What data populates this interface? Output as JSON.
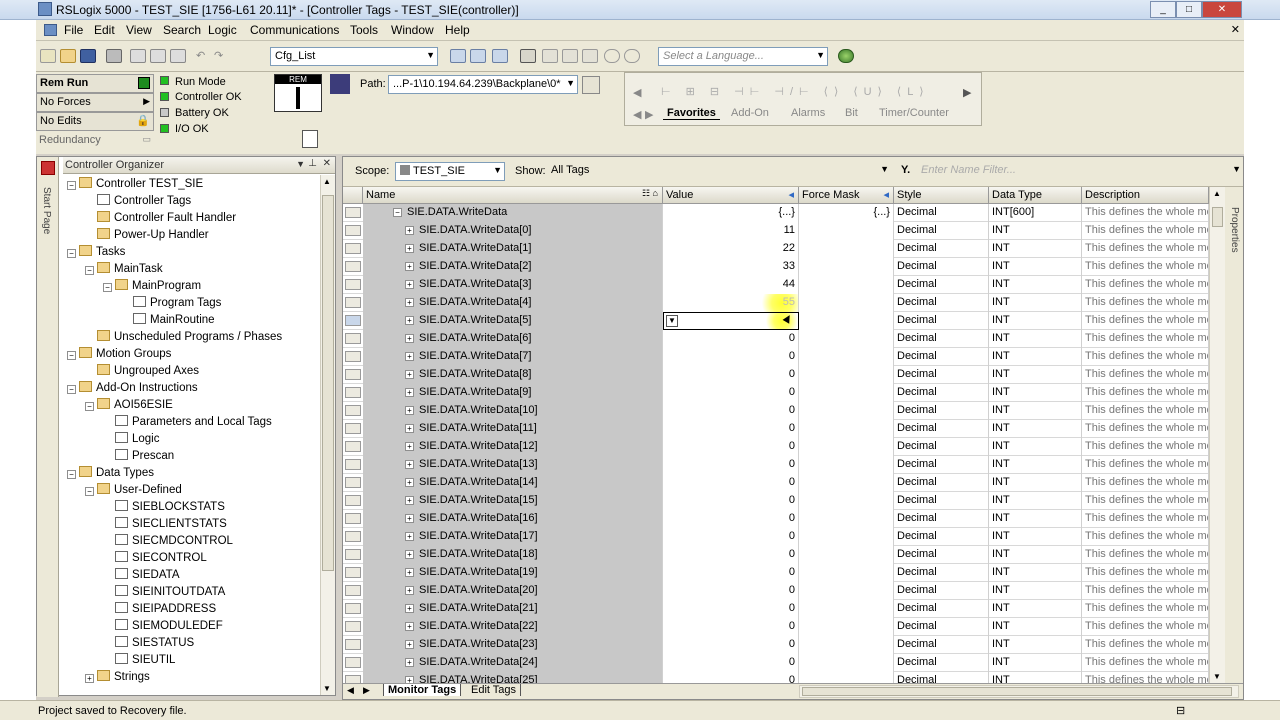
{
  "window": {
    "title": "RSLogix 5000 - TEST_SIE [1756-L61 20.11]* - [Controller Tags - TEST_SIE(controller)]"
  },
  "menu": [
    "File",
    "Edit",
    "View",
    "Search",
    "Logic",
    "Communications",
    "Tools",
    "Window",
    "Help"
  ],
  "toolbar": {
    "routine_combo": "Cfg_List",
    "language_placeholder": "Select a Language..."
  },
  "status": {
    "mode": "Rem Run",
    "forces": "No Forces",
    "edits": "No Edits",
    "redundancy": "Redundancy",
    "leds": [
      {
        "label": "Run Mode",
        "color": "#22c022"
      },
      {
        "label": "Controller OK",
        "color": "#22c022"
      },
      {
        "label": "Battery OK",
        "color": "#c8c8c8"
      },
      {
        "label": "I/O OK",
        "color": "#22c022"
      }
    ],
    "key_label": "REM",
    "path_label": "Path:",
    "path_value": "...P-1\\10.194.64.239\\Backplane\\0*"
  },
  "instruction_tabs": [
    "Favorites",
    "Add-On",
    "Alarms",
    "Bit",
    "Timer/Counter"
  ],
  "organizer": {
    "title": "Controller Organizer",
    "startpage": "Start Page",
    "items": [
      {
        "label": "Controller TEST_SIE",
        "icon": "folder",
        "depth": 0,
        "pm": "-"
      },
      {
        "label": "Controller Tags",
        "icon": "tag",
        "depth": 1
      },
      {
        "label": "Controller Fault Handler",
        "icon": "folder",
        "depth": 1
      },
      {
        "label": "Power-Up Handler",
        "icon": "folder",
        "depth": 1
      },
      {
        "label": "Tasks",
        "icon": "folder",
        "depth": 0,
        "pm": "-"
      },
      {
        "label": "MainTask",
        "icon": "task",
        "depth": 1,
        "pm": "-"
      },
      {
        "label": "MainProgram",
        "icon": "program",
        "depth": 2,
        "pm": "-"
      },
      {
        "label": "Program Tags",
        "icon": "tag",
        "depth": 3
      },
      {
        "label": "MainRoutine",
        "icon": "routine",
        "depth": 3
      },
      {
        "label": "Unscheduled Programs / Phases",
        "icon": "folder",
        "depth": 1
      },
      {
        "label": "Motion Groups",
        "icon": "folder",
        "depth": 0,
        "pm": "-"
      },
      {
        "label": "Ungrouped Axes",
        "icon": "folder",
        "depth": 1
      },
      {
        "label": "Add-On Instructions",
        "icon": "folder",
        "depth": 0,
        "pm": "-"
      },
      {
        "label": "AOI56ESIE",
        "icon": "aoi",
        "depth": 1,
        "pm": "-"
      },
      {
        "label": "Parameters and Local Tags",
        "icon": "tag",
        "depth": 2
      },
      {
        "label": "Logic",
        "icon": "routine",
        "depth": 2
      },
      {
        "label": "Prescan",
        "icon": "routine",
        "depth": 2
      },
      {
        "label": "Data Types",
        "icon": "folder",
        "depth": 0,
        "pm": "-"
      },
      {
        "label": "User-Defined",
        "icon": "folder",
        "depth": 1,
        "pm": "-"
      },
      {
        "label": "SIEBLOCKSTATS",
        "icon": "udt",
        "depth": 2
      },
      {
        "label": "SIECLIENTSTATS",
        "icon": "udt",
        "depth": 2
      },
      {
        "label": "SIECMDCONTROL",
        "icon": "udt",
        "depth": 2
      },
      {
        "label": "SIECONTROL",
        "icon": "udt",
        "depth": 2
      },
      {
        "label": "SIEDATA",
        "icon": "udt",
        "depth": 2
      },
      {
        "label": "SIEINITOUTDATA",
        "icon": "udt",
        "depth": 2
      },
      {
        "label": "SIEIPADDRESS",
        "icon": "udt",
        "depth": 2
      },
      {
        "label": "SIEMODULEDEF",
        "icon": "udt",
        "depth": 2
      },
      {
        "label": "SIESTATUS",
        "icon": "udt",
        "depth": 2
      },
      {
        "label": "SIEUTIL",
        "icon": "udt",
        "depth": 2
      },
      {
        "label": "Strings",
        "icon": "folder",
        "depth": 1,
        "pm": "+"
      }
    ]
  },
  "filter": {
    "scope_label": "Scope:",
    "scope_value": "TEST_SIE",
    "show_label": "Show:",
    "show_value": "All Tags",
    "name_filter_placeholder": "Enter Name Filter..."
  },
  "columns": [
    "Name",
    "Value",
    "Force Mask",
    "Style",
    "Data Type",
    "Description"
  ],
  "rows": [
    {
      "name": "SIE.DATA.WriteData",
      "pm": "-",
      "value": "{...}",
      "force": "{...}",
      "style": "Decimal",
      "type": "INT[600]",
      "desc": "This defines the whole mod",
      "parent": true
    },
    {
      "name": "SIE.DATA.WriteData[0]",
      "pm": "+",
      "value": "11",
      "force": "",
      "style": "Decimal",
      "type": "INT",
      "desc": "This defines the whole mod"
    },
    {
      "name": "SIE.DATA.WriteData[1]",
      "pm": "+",
      "value": "22",
      "force": "",
      "style": "Decimal",
      "type": "INT",
      "desc": "This defines the whole mod"
    },
    {
      "name": "SIE.DATA.WriteData[2]",
      "pm": "+",
      "value": "33",
      "force": "",
      "style": "Decimal",
      "type": "INT",
      "desc": "This defines the whole mod"
    },
    {
      "name": "SIE.DATA.WriteData[3]",
      "pm": "+",
      "value": "44",
      "force": "",
      "style": "Decimal",
      "type": "INT",
      "desc": "This defines the whole mod"
    },
    {
      "name": "SIE.DATA.WriteData[4]",
      "pm": "+",
      "value": "55",
      "force": "",
      "style": "Decimal",
      "type": "INT",
      "desc": "This defines the whole mod",
      "highlight": true
    },
    {
      "name": "SIE.DATA.WriteData[5]",
      "pm": "+",
      "value": "",
      "force": "",
      "style": "Decimal",
      "type": "INT",
      "desc": "This defines the whole mod",
      "editing": true
    },
    {
      "name": "SIE.DATA.WriteData[6]",
      "pm": "+",
      "value": "0",
      "force": "",
      "style": "Decimal",
      "type": "INT",
      "desc": "This defines the whole mod"
    },
    {
      "name": "SIE.DATA.WriteData[7]",
      "pm": "+",
      "value": "0",
      "force": "",
      "style": "Decimal",
      "type": "INT",
      "desc": "This defines the whole mod"
    },
    {
      "name": "SIE.DATA.WriteData[8]",
      "pm": "+",
      "value": "0",
      "force": "",
      "style": "Decimal",
      "type": "INT",
      "desc": "This defines the whole mod"
    },
    {
      "name": "SIE.DATA.WriteData[9]",
      "pm": "+",
      "value": "0",
      "force": "",
      "style": "Decimal",
      "type": "INT",
      "desc": "This defines the whole mod"
    },
    {
      "name": "SIE.DATA.WriteData[10]",
      "pm": "+",
      "value": "0",
      "force": "",
      "style": "Decimal",
      "type": "INT",
      "desc": "This defines the whole mod"
    },
    {
      "name": "SIE.DATA.WriteData[11]",
      "pm": "+",
      "value": "0",
      "force": "",
      "style": "Decimal",
      "type": "INT",
      "desc": "This defines the whole mod"
    },
    {
      "name": "SIE.DATA.WriteData[12]",
      "pm": "+",
      "value": "0",
      "force": "",
      "style": "Decimal",
      "type": "INT",
      "desc": "This defines the whole mod"
    },
    {
      "name": "SIE.DATA.WriteData[13]",
      "pm": "+",
      "value": "0",
      "force": "",
      "style": "Decimal",
      "type": "INT",
      "desc": "This defines the whole mod"
    },
    {
      "name": "SIE.DATA.WriteData[14]",
      "pm": "+",
      "value": "0",
      "force": "",
      "style": "Decimal",
      "type": "INT",
      "desc": "This defines the whole mod"
    },
    {
      "name": "SIE.DATA.WriteData[15]",
      "pm": "+",
      "value": "0",
      "force": "",
      "style": "Decimal",
      "type": "INT",
      "desc": "This defines the whole mod"
    },
    {
      "name": "SIE.DATA.WriteData[16]",
      "pm": "+",
      "value": "0",
      "force": "",
      "style": "Decimal",
      "type": "INT",
      "desc": "This defines the whole mod"
    },
    {
      "name": "SIE.DATA.WriteData[17]",
      "pm": "+",
      "value": "0",
      "force": "",
      "style": "Decimal",
      "type": "INT",
      "desc": "This defines the whole mod"
    },
    {
      "name": "SIE.DATA.WriteData[18]",
      "pm": "+",
      "value": "0",
      "force": "",
      "style": "Decimal",
      "type": "INT",
      "desc": "This defines the whole mod"
    },
    {
      "name": "SIE.DATA.WriteData[19]",
      "pm": "+",
      "value": "0",
      "force": "",
      "style": "Decimal",
      "type": "INT",
      "desc": "This defines the whole mod"
    },
    {
      "name": "SIE.DATA.WriteData[20]",
      "pm": "+",
      "value": "0",
      "force": "",
      "style": "Decimal",
      "type": "INT",
      "desc": "This defines the whole mod"
    },
    {
      "name": "SIE.DATA.WriteData[21]",
      "pm": "+",
      "value": "0",
      "force": "",
      "style": "Decimal",
      "type": "INT",
      "desc": "This defines the whole mod"
    },
    {
      "name": "SIE.DATA.WriteData[22]",
      "pm": "+",
      "value": "0",
      "force": "",
      "style": "Decimal",
      "type": "INT",
      "desc": "This defines the whole mod"
    },
    {
      "name": "SIE.DATA.WriteData[23]",
      "pm": "+",
      "value": "0",
      "force": "",
      "style": "Decimal",
      "type": "INT",
      "desc": "This defines the whole mod"
    },
    {
      "name": "SIE.DATA.WriteData[24]",
      "pm": "+",
      "value": "0",
      "force": "",
      "style": "Decimal",
      "type": "INT",
      "desc": "This defines the whole mod"
    },
    {
      "name": "SIE.DATA.WriteData[25]",
      "pm": "+",
      "value": "0",
      "force": "",
      "style": "Decimal",
      "type": "INT",
      "desc": "This defines the whole mod"
    }
  ],
  "tabs": [
    "Monitor Tags",
    "Edit Tags"
  ],
  "properties_label": "Properties",
  "statusbar": {
    "text": "Project saved to Recovery file."
  },
  "colors": {
    "accent": "#316ac5",
    "grid_name_bg": "#c8c8c8",
    "highlight": "#ffff00"
  }
}
